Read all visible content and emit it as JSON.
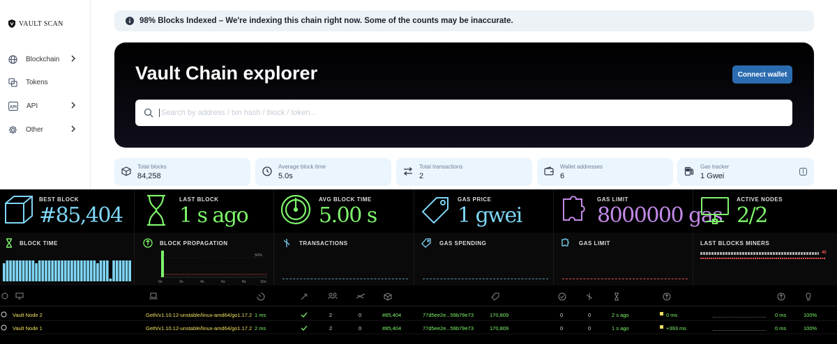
{
  "sidebar": {
    "logo": "VAULT SCAN",
    "items": [
      {
        "label": "Blockchain",
        "icon": "globe-icon",
        "has_submenu": true
      },
      {
        "label": "Tokens",
        "icon": "tokens-icon",
        "has_submenu": false
      },
      {
        "label": "API",
        "icon": "api-icon",
        "has_submenu": true
      },
      {
        "label": "Other",
        "icon": "gear-icon",
        "has_submenu": true
      }
    ]
  },
  "banner": {
    "text": "98% Blocks Indexed – We're indexing this chain right now. Some of the counts may be inaccurate."
  },
  "hero": {
    "title": "Vault Chain explorer",
    "connect_label": "Connect wallet",
    "search_placeholder": "Search by address / txn hash / block / token..."
  },
  "stats": [
    {
      "label": "Total blocks",
      "value": "84,258",
      "icon": "cube-icon"
    },
    {
      "label": "Average block time",
      "value": "5.0s",
      "icon": "clock-icon"
    },
    {
      "label": "Total transactions",
      "value": "2",
      "icon": "transfer-icon"
    },
    {
      "label": "Wallet addresses",
      "value": "6",
      "icon": "wallet-icon"
    },
    {
      "label": "Gas tracker",
      "value": "1 Gwei",
      "icon": "gas-pump-icon",
      "info_icon": "info-icon"
    }
  ],
  "netstats": {
    "tiles": [
      {
        "label": "BEST BLOCK",
        "value": "#85,404",
        "color": "#7fd6f6",
        "icon": "cube-icon"
      },
      {
        "label": "LAST BLOCK",
        "value": "1 s ago",
        "color": "#7ef56b",
        "icon": "hourglass-icon"
      },
      {
        "label": "AVG BLOCK TIME",
        "value": "5.00 s",
        "color": "#7ef56b",
        "icon": "gauge-icon"
      },
      {
        "label": "GAS PRICE",
        "value": "1 gwei",
        "color": "#7fd6f6",
        "icon": "tag-icon"
      },
      {
        "label": "GAS LIMIT",
        "value": "8000000 gas",
        "color": "#c48ae8",
        "icon": "puzzle-icon"
      },
      {
        "label": "ACTIVE NODES",
        "value": "2/2",
        "color": "#7ef56b",
        "icon": "monitor-icon"
      }
    ],
    "charts": [
      {
        "label": "BLOCK TIME",
        "icon": "hourglass-icon"
      },
      {
        "label": "BLOCK PROPAGATION",
        "icon": "propagation-icon",
        "percent_label": "50%",
        "ticks": [
          "0s",
          "2s",
          "4s",
          "6s",
          "8s",
          "10s"
        ]
      },
      {
        "label": "TRANSACTIONS",
        "icon": "transactions-icon"
      },
      {
        "label": "GAS SPENDING",
        "icon": "tag-icon"
      },
      {
        "label": "GAS LIMIT",
        "icon": "puzzle-icon"
      },
      {
        "label": "LAST BLOCKS MINERS",
        "icon": "",
        "miner_value": "40"
      }
    ],
    "nodes": [
      {
        "name": "Vault Node 2",
        "client": "Geth/v1.10.12-unstable/linux-amd64/go1.17.2",
        "latency": "1 ms",
        "peers": "2",
        "pending": "0",
        "block": "#85,404",
        "hash": "77d5ee2e...59b79e73",
        "difficulty": "170,809",
        "c1": "0",
        "c2": "0",
        "last_block": "2 s ago",
        "propagation": "0 ms",
        "avg_prop": "0 ms",
        "uptime": "100%"
      },
      {
        "name": "Vault Node 1",
        "client": "Geth/v1.10.12-unstable/linux-amd64/go1.17.2",
        "latency": "2 ms",
        "peers": "2",
        "pending": "0",
        "block": "#85,404",
        "hash": "77d5ee2e...59b79e73",
        "difficulty": "170,809",
        "c1": "0",
        "c2": "0",
        "last_block": "1 s ago",
        "propagation": "+393 ms",
        "avg_prop": "0 ms",
        "uptime": "100%"
      }
    ]
  }
}
